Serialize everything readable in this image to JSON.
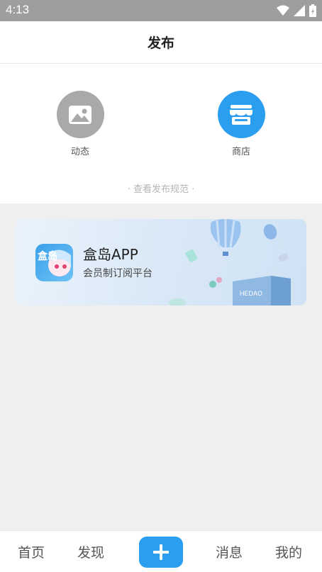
{
  "status_bar": {
    "time": "4:13",
    "icons": [
      "wifi-icon",
      "signal-icon",
      "battery-icon"
    ]
  },
  "header": {
    "title": "发布"
  },
  "options": [
    {
      "label": "动态",
      "icon": "image-icon",
      "color": "#a9a9a9"
    },
    {
      "label": "商店",
      "icon": "store-icon",
      "color": "#2b9ef0"
    }
  ],
  "rules_link": "· 查看发布规范 ·",
  "banner": {
    "title": "盒岛APP",
    "subtitle": "会员制订阅平台",
    "art_label": "HEDAO",
    "logo_text": "盒岛"
  },
  "bottom_nav": {
    "items": [
      {
        "label": "首页"
      },
      {
        "label": "发现"
      },
      {
        "label": "消息"
      },
      {
        "label": "我的"
      }
    ],
    "add_icon": "plus-icon",
    "accent": "#2b9ef0"
  }
}
